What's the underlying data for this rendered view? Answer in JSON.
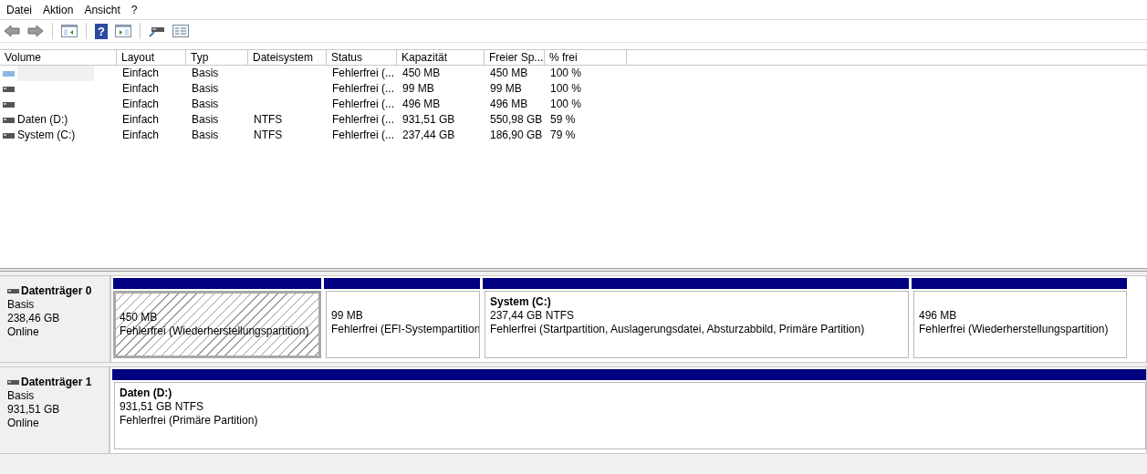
{
  "menu": [
    "Datei",
    "Aktion",
    "Ansicht",
    "?"
  ],
  "toolbar": [
    {
      "kind": "back"
    },
    {
      "kind": "forward"
    },
    {
      "kind": "sep"
    },
    {
      "kind": "tree"
    },
    {
      "kind": "sep"
    },
    {
      "kind": "help",
      "glyph": "?"
    },
    {
      "kind": "pane"
    },
    {
      "kind": "sep"
    },
    {
      "kind": "disk"
    },
    {
      "kind": "list"
    }
  ],
  "table": {
    "columns": [
      "Volume",
      "Layout",
      "Typ",
      "Dateisystem",
      "Status",
      "Kapazität",
      "Freier Sp...",
      "% frei"
    ],
    "rows": [
      {
        "selected": true,
        "kind": "striped",
        "cells": [
          "",
          "Einfach",
          "Basis",
          "",
          "Fehlerfrei (...",
          "450 MB",
          "450 MB",
          "100 %"
        ]
      },
      {
        "selected": false,
        "kind": "drive",
        "cells": [
          "",
          "Einfach",
          "Basis",
          "",
          "Fehlerfrei (...",
          "99 MB",
          "99 MB",
          "100 %"
        ]
      },
      {
        "selected": false,
        "kind": "drive",
        "cells": [
          "",
          "Einfach",
          "Basis",
          "",
          "Fehlerfrei (...",
          "496 MB",
          "496 MB",
          "100 %"
        ]
      },
      {
        "selected": false,
        "kind": "drive",
        "cells": [
          "Daten (D:)",
          "Einfach",
          "Basis",
          "NTFS",
          "Fehlerfrei (...",
          "931,51 GB",
          "550,98 GB",
          "59 %"
        ]
      },
      {
        "selected": false,
        "kind": "drive",
        "cells": [
          "System (C:)",
          "Einfach",
          "Basis",
          "NTFS",
          "Fehlerfrei (...",
          "237,44 GB",
          "186,90 GB",
          "79 %"
        ]
      }
    ]
  },
  "disks": [
    {
      "name": "Datenträger 0",
      "type": "Basis",
      "size": "238,46 GB",
      "state": "Online",
      "partitions": [
        {
          "selected": true,
          "size": "450 MB",
          "status": "Fehlerfrei (Wiederherstellungspartition)"
        },
        {
          "selected": false,
          "size": "99 MB",
          "status": "Fehlerfrei (EFI-Systempartition"
        },
        {
          "selected": false,
          "name": "System  (C:)",
          "size": "237,44 GB NTFS",
          "status": "Fehlerfrei (Startpartition, Auslagerungsdatei, Absturzabbild, Primäre Partition)"
        },
        {
          "selected": false,
          "size": "496 MB",
          "status": "Fehlerfrei (Wiederherstellungspartition)"
        }
      ]
    },
    {
      "name": "Datenträger 1",
      "type": "Basis",
      "size": "931,51 GB",
      "state": "Online",
      "partitions": [
        {
          "selected": false,
          "name": "Daten  (D:)",
          "size": "931,51 GB NTFS",
          "status": "Fehlerfrei (Primäre Partition)"
        }
      ]
    }
  ]
}
